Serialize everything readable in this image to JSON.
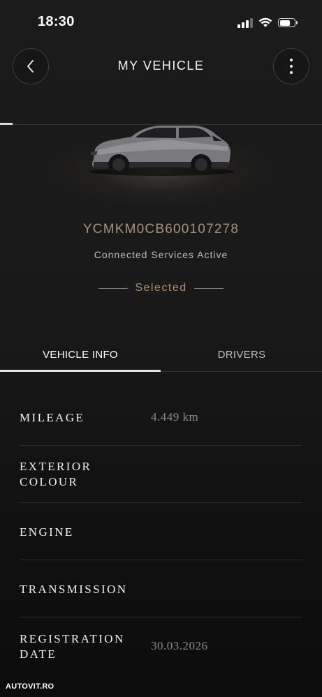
{
  "status_bar": {
    "time": "18:30",
    "icons": [
      "cellular-signal-icon",
      "wifi-icon",
      "battery-icon"
    ]
  },
  "header": {
    "title": "MY VEHICLE",
    "back_icon": "chevron-left-icon",
    "menu_icon": "more-vertical-icon"
  },
  "vehicle": {
    "vin": "YCMKM0CB600107278",
    "connection_status": "Connected Services Active",
    "selection_label": "Selected"
  },
  "tabs": [
    {
      "label": "VEHICLE INFO",
      "active": true
    },
    {
      "label": "DRIVERS",
      "active": false
    }
  ],
  "info": {
    "mileage": {
      "label": "MILEAGE",
      "value": "4.449 km"
    },
    "exterior_colour": {
      "label_line1": "EXTERIOR",
      "label_line2": "COLOUR",
      "value": ""
    },
    "engine": {
      "label": "ENGINE",
      "value": ""
    },
    "transmission": {
      "label": "TRANSMISSION",
      "value": ""
    },
    "registration_date": {
      "label_line1": "REGISTRATION",
      "label_line2": "DATE",
      "value": "30.03.2026"
    }
  },
  "watermark": "AUTOVIT.RO",
  "colors": {
    "accent_gold": "#a89274",
    "background": "#171717",
    "text_primary": "#f0f0f0",
    "text_muted": "#8a8a8a"
  }
}
